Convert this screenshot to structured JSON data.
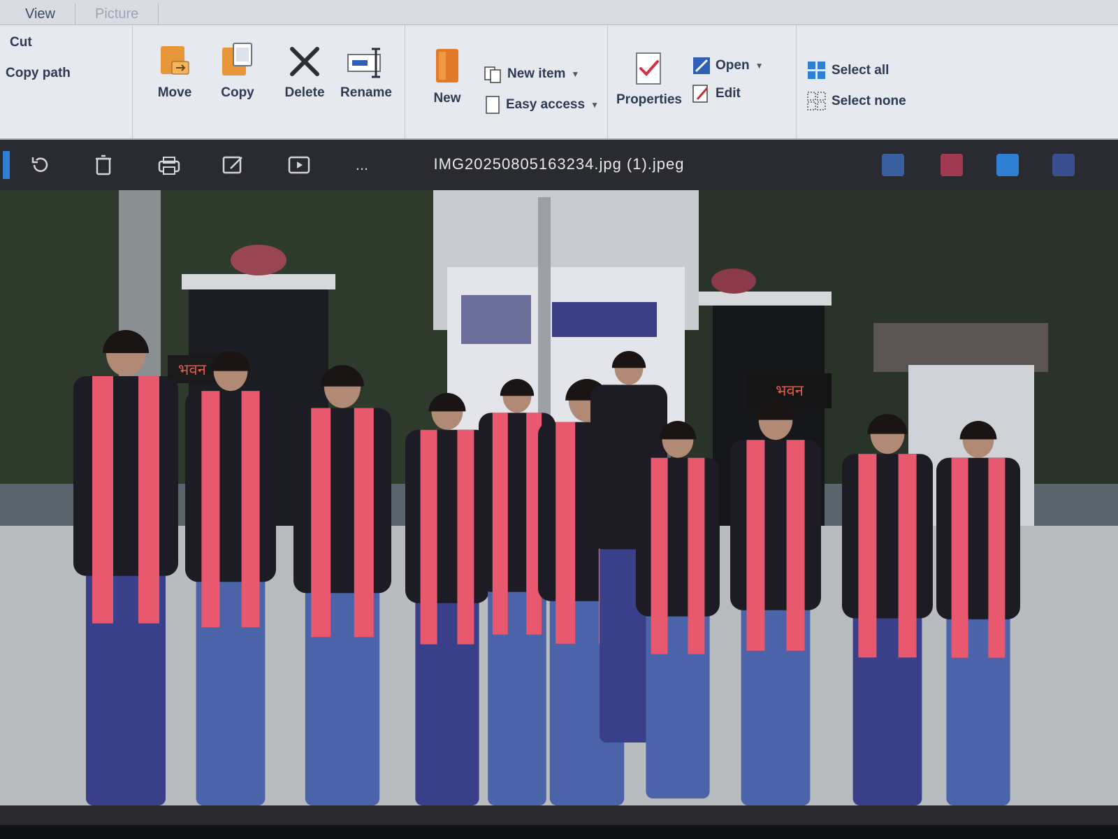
{
  "tabs": [
    {
      "label": "View"
    },
    {
      "label": "Picture"
    }
  ],
  "ribbon": {
    "clipboard": {
      "cut_label": "Cut",
      "copy_path_label": "Copy path"
    },
    "organize": {
      "move_label": "Move",
      "copy_label": "Copy",
      "delete_label": "Delete",
      "rename_label": "Rename"
    },
    "new_group": {
      "new_label": "New",
      "new_item_label": "New item",
      "easy_access_label": "Easy access"
    },
    "open_group": {
      "properties_label": "Properties",
      "open_label": "Open",
      "edit_label": "Edit"
    },
    "select_group": {
      "select_all_label": "Select all",
      "select_none_label": "Select none"
    }
  },
  "viewer": {
    "file_title": "IMG20250805163234.jpg (1).jpeg",
    "icons": [
      "rotate-icon",
      "delete-icon",
      "print-icon",
      "edit-icon",
      "slideshow-icon",
      "more-icon"
    ],
    "more_label": "..."
  },
  "photo": {
    "description_icon": "group-photo",
    "sign_left": "भवन",
    "sign_right": "भवन"
  },
  "colors": {
    "ribbon_bg": "#e6e9ee",
    "viewer_bg": "#2a2b30",
    "scarf": "#e8586e"
  }
}
